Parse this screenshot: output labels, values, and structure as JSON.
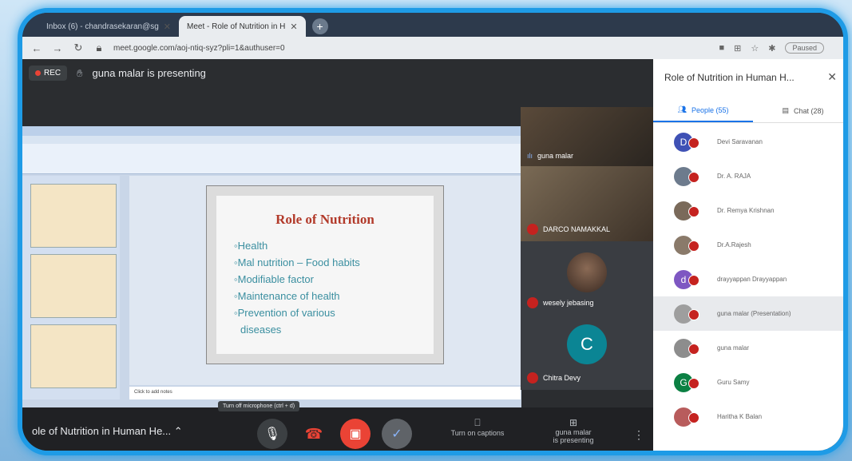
{
  "browser": {
    "tabs": [
      {
        "label": "Inbox (6) - chandrasekaran@sg",
        "active": false
      },
      {
        "label": "Meet - Role of Nutrition in H",
        "active": true
      }
    ],
    "url": "meet.google.com/aoj-ntiq-syz?pli=1&authuser=0",
    "paused_label": "Paused"
  },
  "meet": {
    "rec_label": "REC",
    "presenting_text": "guna malar is presenting",
    "tiles": [
      {
        "name": "guna malar"
      },
      {
        "name": "DARCO NAMAKKAL"
      },
      {
        "name": "wesely jebasing"
      },
      {
        "name": "Chitra Devy",
        "initial": "C"
      }
    ],
    "bottom_title": "ole of Nutrition in Human He...",
    "tooltip": "Turn off microphone (ctrl + d)",
    "captions_label": "Turn on captions",
    "present_label_1": "guna malar",
    "present_label_2": "is presenting"
  },
  "slide": {
    "title": "Role of Nutrition",
    "bullets": [
      "Health",
      "Mal nutrition – Food habits",
      "Modifiable factor",
      "Maintenance of health",
      "Prevention of various",
      "diseases"
    ],
    "notes_placeholder": "Click to add notes"
  },
  "panel": {
    "title": "Role of Nutrition in Human H...",
    "people_tab": "People (55)",
    "chat_tab": "Chat (28)",
    "people": [
      {
        "name": "Devi Saravanan",
        "initial": "D",
        "color": "#3f51b5"
      },
      {
        "name": "Dr. A. RAJA",
        "initial": "",
        "color": "#6d7b8d"
      },
      {
        "name": "Dr. Remya Krishnan",
        "initial": "",
        "color": "#7a6a5a"
      },
      {
        "name": "Dr.A.Rajesh",
        "initial": "",
        "color": "#8a7a6a"
      },
      {
        "name": "drayyappan Drayyappan",
        "initial": "d",
        "color": "#7e57c2"
      },
      {
        "name": "guna malar (Presentation)",
        "initial": "",
        "color": "#9e9e9e"
      },
      {
        "name": "guna malar",
        "initial": "",
        "color": "#8d8d8d"
      },
      {
        "name": "Guru Samy",
        "initial": "G",
        "color": "#0b8043"
      },
      {
        "name": "Haritha K Balan",
        "initial": "",
        "color": "#b85c5c"
      }
    ]
  }
}
